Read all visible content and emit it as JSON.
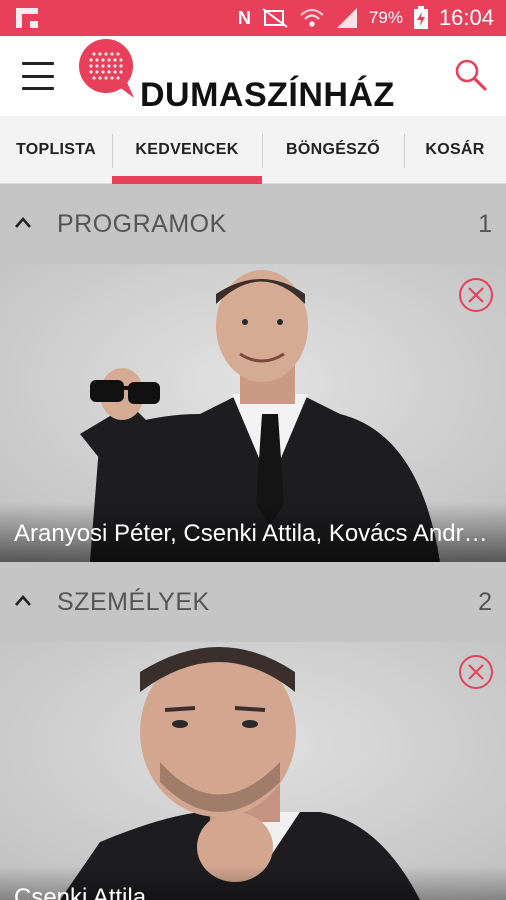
{
  "status_bar": {
    "battery_percent": "79%",
    "time": "16:04",
    "icons": [
      "flipboard-icon",
      "nfc-icon",
      "mute-icon",
      "wifi-icon",
      "signal-icon",
      "battery-charging-icon"
    ]
  },
  "app_bar": {
    "logo_text": "DUMASZÍNHÁZ",
    "icons": [
      "menu-icon",
      "search-icon"
    ]
  },
  "tabs": [
    {
      "label": "TOPLISTA",
      "active": false
    },
    {
      "label": "KEDVENCEK",
      "active": true
    },
    {
      "label": "BÖNGÉSZŐ",
      "active": false
    },
    {
      "label": "KOSÁR",
      "active": false
    }
  ],
  "sections": [
    {
      "title": "PROGRAMOK",
      "count": "1",
      "items": [
        {
          "caption": "Aranyosi Péter, Csenki Attila, Kovács András Péter"
        }
      ]
    },
    {
      "title": "SZEMÉLYEK",
      "count": "2",
      "items": [
        {
          "caption": "Csenki Attila"
        }
      ]
    }
  ],
  "colors": {
    "accent": "#e8405a",
    "header_bg": "#c5c5c5",
    "tabs_bg": "#f3f3f3"
  }
}
